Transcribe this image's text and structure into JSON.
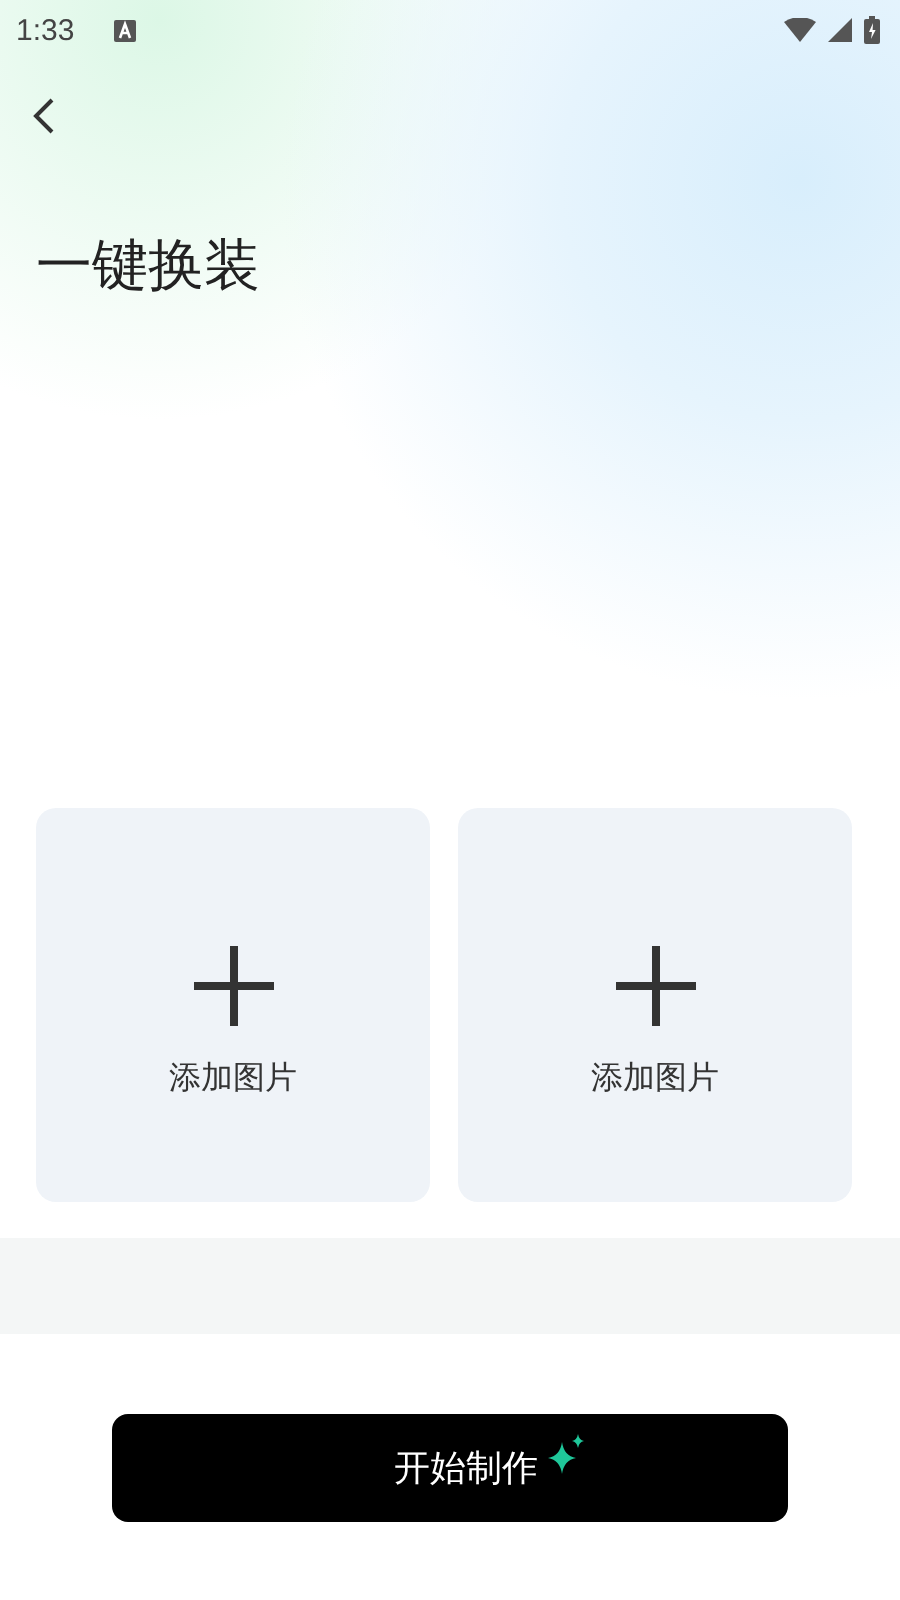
{
  "status_bar": {
    "time": "1:33"
  },
  "title": "一键换装",
  "upload_slots": [
    {
      "label": "添加图片"
    },
    {
      "label": "添加图片"
    }
  ],
  "action_button": {
    "label": "开始制作"
  }
}
